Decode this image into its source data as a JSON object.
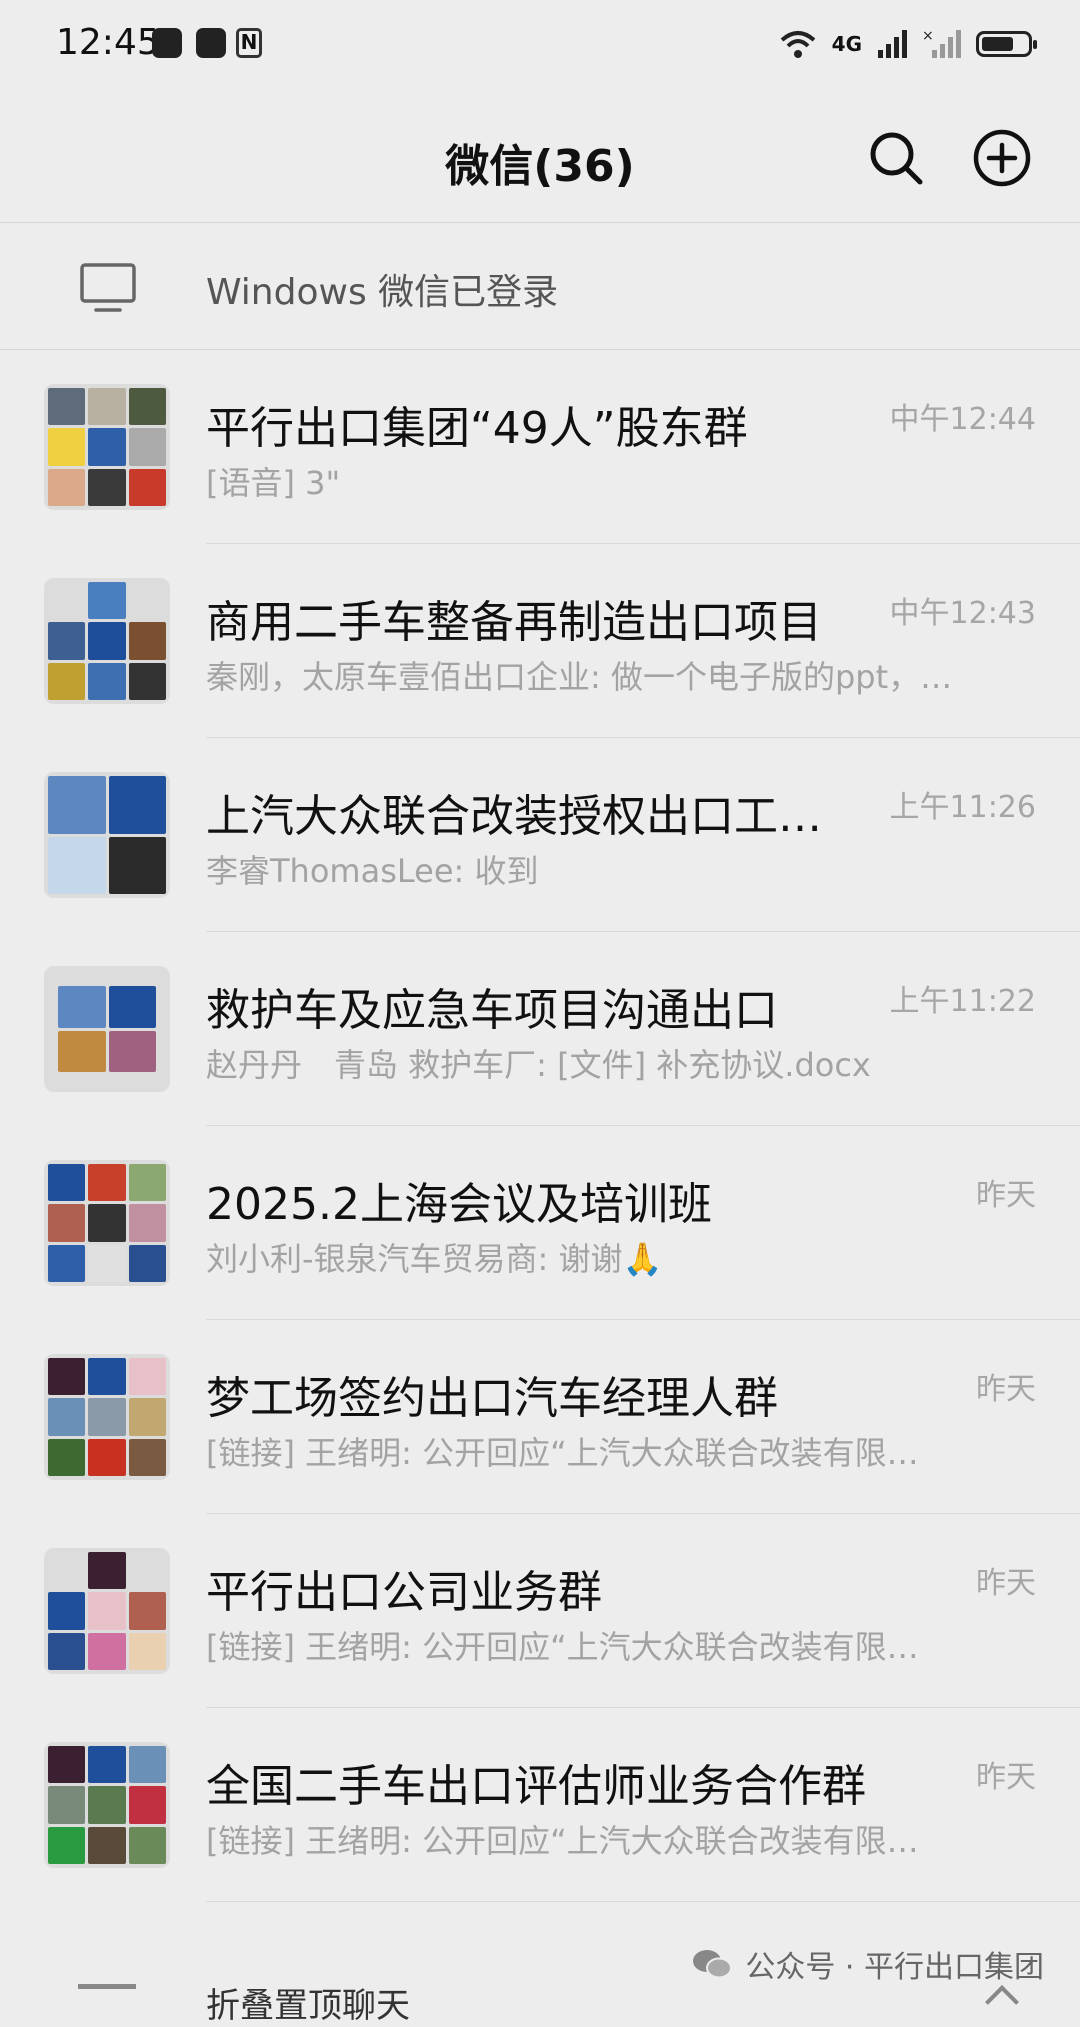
{
  "status_bar": {
    "time": "12:45",
    "network": "4G"
  },
  "header": {
    "title": "微信(36)",
    "icons": [
      "search-icon",
      "plus-circle-icon"
    ]
  },
  "login_bar": {
    "text": "Windows 微信已登录",
    "icon": "desktop-monitor-icon"
  },
  "chats": [
    {
      "name": "平行出口集团“49人”股东群",
      "time": "中午12:44",
      "message": "[语音] 3\""
    },
    {
      "name": "商用二手车整备再制造出口项目",
      "time": "中午12:43",
      "message": "秦刚，太原车壹佰出口企业: 做一个电子版的ppt，…"
    },
    {
      "name": "上汽大众联合改装授权出口工…",
      "time": "上午11:26",
      "message": "李睿ThomasLee: 收到"
    },
    {
      "name": "救护车及应急车项目沟通出口",
      "time": "上午11:22",
      "message": "赵丹丹　青岛 救护车厂: [文件] 补充协议.docx"
    },
    {
      "name": "2025.2上海会议及培训班",
      "time": "昨天",
      "message": "刘小利-银泉汽车贸易商: 谢谢🙏"
    },
    {
      "name": "梦工场签约出口汽车经理人群",
      "time": "昨天",
      "message": "[链接] 王绪明:  公开回应“上汽大众联合改装有限…"
    },
    {
      "name": "平行出口公司业务群",
      "time": "昨天",
      "message": "[链接] 王绪明:  公开回应“上汽大众联合改装有限…"
    },
    {
      "name": "全国二手车出口评估师业务合作群",
      "time": "昨天",
      "message": "[链接] 王绪明:  公开回应“上汽大众联合改装有限…"
    }
  ],
  "bottom": {
    "fold_label": "折叠置顶聊天",
    "watermark": "公众号 · 平行出口集团"
  },
  "colors": {
    "background": "#ededed",
    "text": "#111111",
    "secondary_text": "#a3a3a3",
    "divider": "#d9d9d9"
  }
}
